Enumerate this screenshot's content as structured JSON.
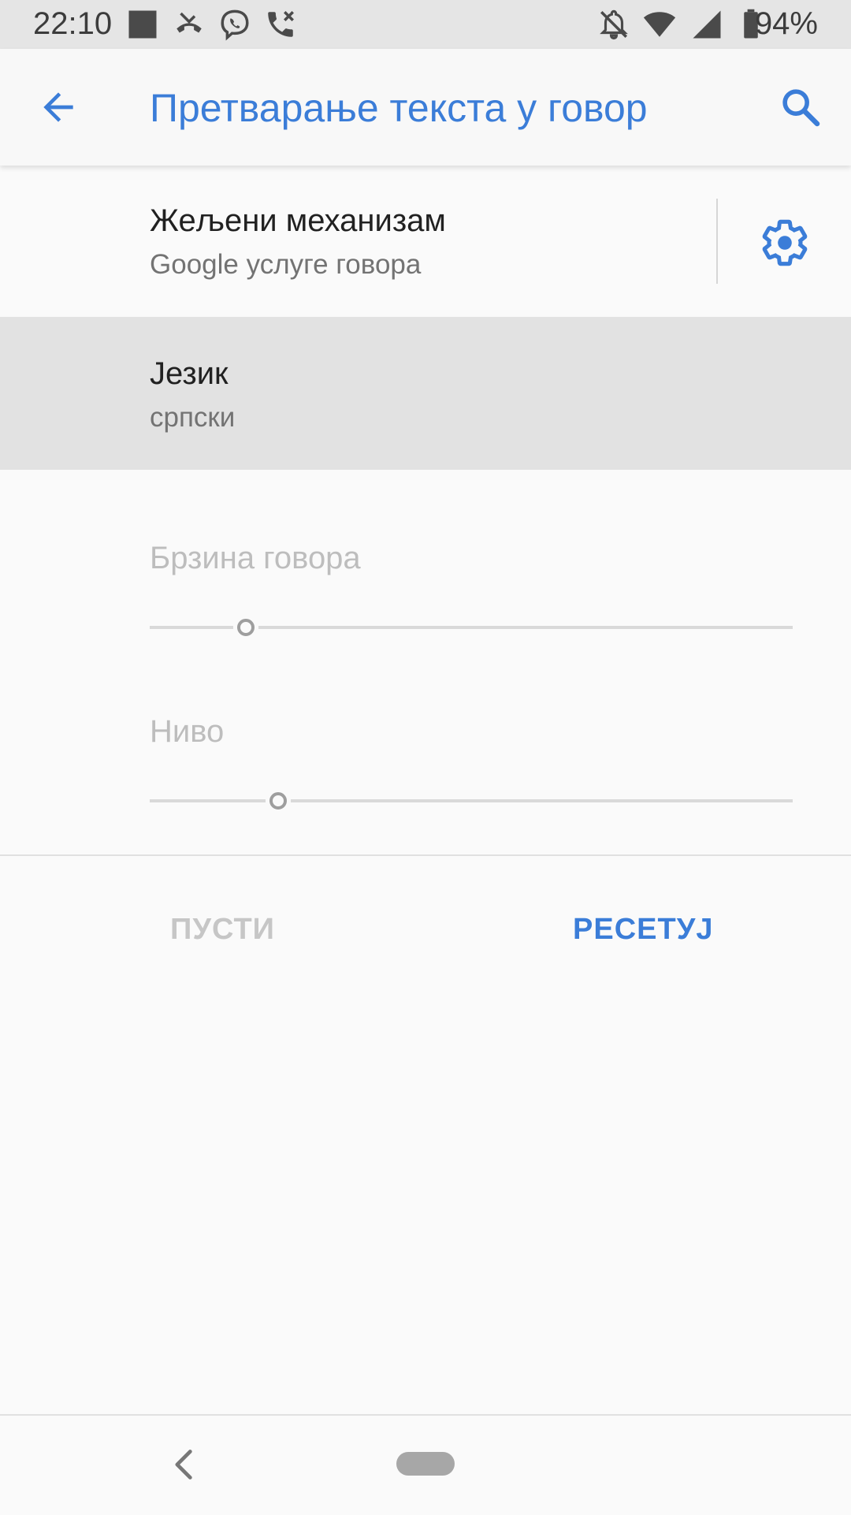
{
  "status_bar": {
    "time": "22:10",
    "battery_text": "94%",
    "icons": [
      "square-notification-icon",
      "missed-call-icon",
      "viber-icon",
      "call-cancel-icon",
      "notifications-off-icon",
      "wifi-icon",
      "cell-signal-icon",
      "battery-icon"
    ]
  },
  "app_bar": {
    "title": "Претварање текста у говор",
    "back_icon": "arrow-back-icon",
    "search_icon": "search-icon"
  },
  "preferred_engine": {
    "title": "Жељени механизам",
    "subtitle": "Google услуге говора",
    "settings_icon": "gear-icon"
  },
  "language": {
    "title": "Језик",
    "subtitle": "српски"
  },
  "speech_rate": {
    "label": "Брзина говора",
    "value_fraction": 0.15
  },
  "pitch": {
    "label": "Ниво",
    "value_fraction": 0.2
  },
  "actions": {
    "play_label": "ПУСТИ",
    "reset_label": "РЕСЕТУЈ"
  },
  "colors": {
    "accent": "#3b7dd8",
    "disabled": "#bdbdbd",
    "selected_row": "#e2e2e2"
  }
}
